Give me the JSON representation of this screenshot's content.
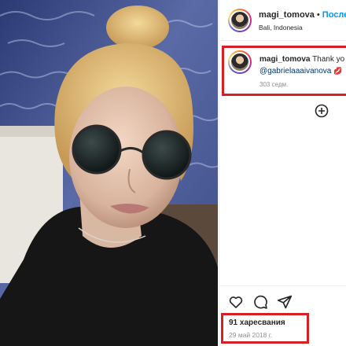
{
  "post": {
    "username": "magi_tomova",
    "dot": "•",
    "follow_label": "После",
    "location": "Bali, Indonesia"
  },
  "comment": {
    "username": "magi_tomova",
    "text": "Thank yo",
    "mention": "@gabrielaaaivanova",
    "emoji": "💋",
    "time": "303 седм."
  },
  "actions": {
    "like_icon": "heart-icon",
    "comment_icon": "comment-icon",
    "share_icon": "send-icon",
    "add_icon": "plus-circle-icon"
  },
  "stats": {
    "likes": "91 харесвания",
    "date": "29 май 2018 г."
  },
  "colors": {
    "highlight": "#d81f26",
    "follow": "#0095f6",
    "mention": "#00376b",
    "muted": "#8e8e8e"
  }
}
